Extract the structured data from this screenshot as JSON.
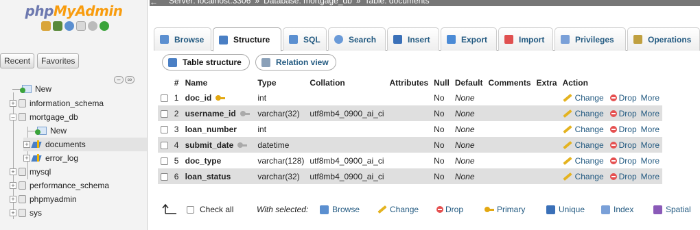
{
  "nav": {
    "logo_php": "php",
    "logo_rest": "MyAdmin",
    "recent_label": "Recent",
    "favorites_label": "Favorites",
    "tree": [
      {
        "label": "New",
        "kind": "new",
        "level": 0
      },
      {
        "label": "information_schema",
        "kind": "db",
        "level": 0
      },
      {
        "label": "mortgage_db",
        "kind": "db",
        "level": 0,
        "expanded": true
      },
      {
        "label": "New",
        "kind": "new",
        "level": 1
      },
      {
        "label": "documents",
        "kind": "table",
        "level": 1,
        "selected": true
      },
      {
        "label": "error_log",
        "kind": "table",
        "level": 1
      },
      {
        "label": "mysql",
        "kind": "db",
        "level": 0
      },
      {
        "label": "performance_schema",
        "kind": "db",
        "level": 0
      },
      {
        "label": "phpmyadmin",
        "kind": "db",
        "level": 0
      },
      {
        "label": "sys",
        "kind": "db",
        "level": 0
      }
    ]
  },
  "breadcrumb": {
    "back": "←",
    "server": "Server: localhost:3306",
    "sep": "»",
    "database": "Database: mortgage_db",
    "table": "Table: documents"
  },
  "tabs": [
    {
      "label": "Browse",
      "icon": "browse-icon",
      "color": "#5b8fd0"
    },
    {
      "label": "Structure",
      "icon": "structure-icon",
      "color": "#4a7fc4",
      "active": true
    },
    {
      "label": "SQL",
      "icon": "sql-icon",
      "color": "#5b8fd0"
    },
    {
      "label": "Search",
      "icon": "search-icon",
      "color": "#6a9ad8"
    },
    {
      "label": "Insert",
      "icon": "insert-icon",
      "color": "#3a70b8"
    },
    {
      "label": "Export",
      "icon": "export-icon",
      "color": "#4b8bd6"
    },
    {
      "label": "Import",
      "icon": "import-icon",
      "color": "#e05050"
    },
    {
      "label": "Privileges",
      "icon": "privileges-icon",
      "color": "#7aa0d8"
    },
    {
      "label": "Operations",
      "icon": "operations-icon",
      "color": "#c0a040"
    }
  ],
  "subtabs": {
    "table_structure": "Table structure",
    "relation_view": "Relation view"
  },
  "table": {
    "headers": {
      "num": "#",
      "name": "Name",
      "type": "Type",
      "collation": "Collation",
      "attributes": "Attributes",
      "null": "Null",
      "default": "Default",
      "comments": "Comments",
      "extra": "Extra",
      "action": "Action"
    },
    "rows": [
      {
        "num": "1",
        "name": "doc_id",
        "key": "primary",
        "type": "int",
        "collation": "",
        "null": "No",
        "default": "None"
      },
      {
        "num": "2",
        "name": "username_id",
        "key": "index",
        "type": "varchar(32)",
        "collation": "utf8mb4_0900_ai_ci",
        "null": "No",
        "default": "None"
      },
      {
        "num": "3",
        "name": "loan_number",
        "key": "",
        "type": "int",
        "collation": "",
        "null": "No",
        "default": "None"
      },
      {
        "num": "4",
        "name": "submit_date",
        "key": "index",
        "type": "datetime",
        "collation": "",
        "null": "No",
        "default": "None"
      },
      {
        "num": "5",
        "name": "doc_type",
        "key": "",
        "type": "varchar(128)",
        "collation": "utf8mb4_0900_ai_ci",
        "null": "No",
        "default": "None"
      },
      {
        "num": "6",
        "name": "loan_status",
        "key": "",
        "type": "varchar(32)",
        "collation": "utf8mb4_0900_ai_ci",
        "null": "No",
        "default": "None"
      }
    ],
    "action_change": "Change",
    "action_drop": "Drop",
    "action_more": "More"
  },
  "bottom": {
    "check_all": "Check all",
    "with_selected": "With selected:",
    "browse": "Browse",
    "change": "Change",
    "drop": "Drop",
    "primary": "Primary",
    "unique": "Unique",
    "index": "Index",
    "spatial": "Spatial"
  }
}
